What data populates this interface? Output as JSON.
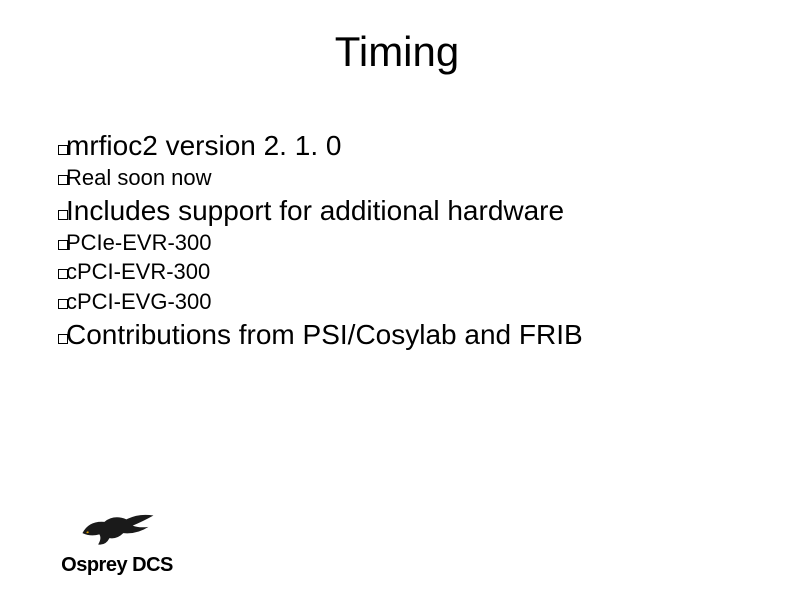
{
  "title": "Timing",
  "lines": {
    "a": "mrfioc2 version 2. 1. 0",
    "b": "Real soon now",
    "c": "Includes support for additional hardware",
    "d": "PCIe-EVR-300",
    "e": "cPCI-EVR-300",
    "f": "cPCI-EVG-300",
    "g": "Contributions from PSI/Cosylab and FRIB"
  },
  "logo_text": "Osprey DCS"
}
